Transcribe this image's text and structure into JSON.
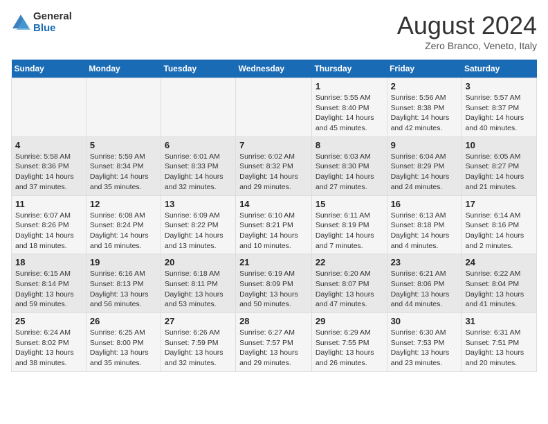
{
  "logo": {
    "general": "General",
    "blue": "Blue"
  },
  "header": {
    "month": "August 2024",
    "location": "Zero Branco, Veneto, Italy"
  },
  "days_of_week": [
    "Sunday",
    "Monday",
    "Tuesday",
    "Wednesday",
    "Thursday",
    "Friday",
    "Saturday"
  ],
  "weeks": [
    [
      {
        "day": "",
        "info": ""
      },
      {
        "day": "",
        "info": ""
      },
      {
        "day": "",
        "info": ""
      },
      {
        "day": "",
        "info": ""
      },
      {
        "day": "1",
        "info": "Sunrise: 5:55 AM\nSunset: 8:40 PM\nDaylight: 14 hours and 45 minutes."
      },
      {
        "day": "2",
        "info": "Sunrise: 5:56 AM\nSunset: 8:38 PM\nDaylight: 14 hours and 42 minutes."
      },
      {
        "day": "3",
        "info": "Sunrise: 5:57 AM\nSunset: 8:37 PM\nDaylight: 14 hours and 40 minutes."
      }
    ],
    [
      {
        "day": "4",
        "info": "Sunrise: 5:58 AM\nSunset: 8:36 PM\nDaylight: 14 hours and 37 minutes."
      },
      {
        "day": "5",
        "info": "Sunrise: 5:59 AM\nSunset: 8:34 PM\nDaylight: 14 hours and 35 minutes."
      },
      {
        "day": "6",
        "info": "Sunrise: 6:01 AM\nSunset: 8:33 PM\nDaylight: 14 hours and 32 minutes."
      },
      {
        "day": "7",
        "info": "Sunrise: 6:02 AM\nSunset: 8:32 PM\nDaylight: 14 hours and 29 minutes."
      },
      {
        "day": "8",
        "info": "Sunrise: 6:03 AM\nSunset: 8:30 PM\nDaylight: 14 hours and 27 minutes."
      },
      {
        "day": "9",
        "info": "Sunrise: 6:04 AM\nSunset: 8:29 PM\nDaylight: 14 hours and 24 minutes."
      },
      {
        "day": "10",
        "info": "Sunrise: 6:05 AM\nSunset: 8:27 PM\nDaylight: 14 hours and 21 minutes."
      }
    ],
    [
      {
        "day": "11",
        "info": "Sunrise: 6:07 AM\nSunset: 8:26 PM\nDaylight: 14 hours and 18 minutes."
      },
      {
        "day": "12",
        "info": "Sunrise: 6:08 AM\nSunset: 8:24 PM\nDaylight: 14 hours and 16 minutes."
      },
      {
        "day": "13",
        "info": "Sunrise: 6:09 AM\nSunset: 8:22 PM\nDaylight: 14 hours and 13 minutes."
      },
      {
        "day": "14",
        "info": "Sunrise: 6:10 AM\nSunset: 8:21 PM\nDaylight: 14 hours and 10 minutes."
      },
      {
        "day": "15",
        "info": "Sunrise: 6:11 AM\nSunset: 8:19 PM\nDaylight: 14 hours and 7 minutes."
      },
      {
        "day": "16",
        "info": "Sunrise: 6:13 AM\nSunset: 8:18 PM\nDaylight: 14 hours and 4 minutes."
      },
      {
        "day": "17",
        "info": "Sunrise: 6:14 AM\nSunset: 8:16 PM\nDaylight: 14 hours and 2 minutes."
      }
    ],
    [
      {
        "day": "18",
        "info": "Sunrise: 6:15 AM\nSunset: 8:14 PM\nDaylight: 13 hours and 59 minutes."
      },
      {
        "day": "19",
        "info": "Sunrise: 6:16 AM\nSunset: 8:13 PM\nDaylight: 13 hours and 56 minutes."
      },
      {
        "day": "20",
        "info": "Sunrise: 6:18 AM\nSunset: 8:11 PM\nDaylight: 13 hours and 53 minutes."
      },
      {
        "day": "21",
        "info": "Sunrise: 6:19 AM\nSunset: 8:09 PM\nDaylight: 13 hours and 50 minutes."
      },
      {
        "day": "22",
        "info": "Sunrise: 6:20 AM\nSunset: 8:07 PM\nDaylight: 13 hours and 47 minutes."
      },
      {
        "day": "23",
        "info": "Sunrise: 6:21 AM\nSunset: 8:06 PM\nDaylight: 13 hours and 44 minutes."
      },
      {
        "day": "24",
        "info": "Sunrise: 6:22 AM\nSunset: 8:04 PM\nDaylight: 13 hours and 41 minutes."
      }
    ],
    [
      {
        "day": "25",
        "info": "Sunrise: 6:24 AM\nSunset: 8:02 PM\nDaylight: 13 hours and 38 minutes."
      },
      {
        "day": "26",
        "info": "Sunrise: 6:25 AM\nSunset: 8:00 PM\nDaylight: 13 hours and 35 minutes."
      },
      {
        "day": "27",
        "info": "Sunrise: 6:26 AM\nSunset: 7:59 PM\nDaylight: 13 hours and 32 minutes."
      },
      {
        "day": "28",
        "info": "Sunrise: 6:27 AM\nSunset: 7:57 PM\nDaylight: 13 hours and 29 minutes."
      },
      {
        "day": "29",
        "info": "Sunrise: 6:29 AM\nSunset: 7:55 PM\nDaylight: 13 hours and 26 minutes."
      },
      {
        "day": "30",
        "info": "Sunrise: 6:30 AM\nSunset: 7:53 PM\nDaylight: 13 hours and 23 minutes."
      },
      {
        "day": "31",
        "info": "Sunrise: 6:31 AM\nSunset: 7:51 PM\nDaylight: 13 hours and 20 minutes."
      }
    ]
  ]
}
